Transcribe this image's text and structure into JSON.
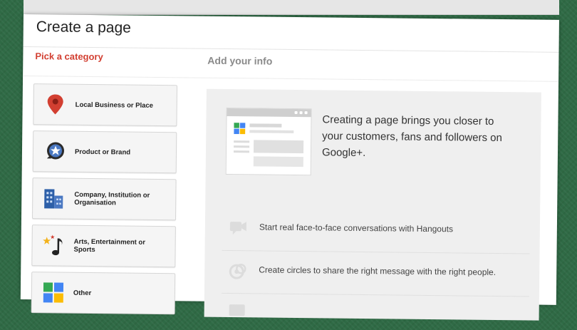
{
  "page": {
    "title": "Create a page",
    "tabs": {
      "pick_category": "Pick a category",
      "add_info": "Add your info"
    }
  },
  "categories": [
    {
      "label": "Local Business or Place",
      "icon": "map-pin-icon"
    },
    {
      "label": "Product or Brand",
      "icon": "star-badge-icon"
    },
    {
      "label": "Company, Institution or Organisation",
      "icon": "building-icon"
    },
    {
      "label": "Arts, Entertainment or Sports",
      "icon": "music-note-icon"
    },
    {
      "label": "Other",
      "icon": "grid-squares-icon"
    }
  ],
  "info": {
    "headline": "Creating a page brings you closer to your customers, fans and followers on Google+.",
    "features": [
      {
        "text": "Start real face-to-face conversations with Hangouts",
        "icon": "hangouts-icon"
      },
      {
        "text": "Create circles to share the right message with the right people.",
        "icon": "circles-icon"
      }
    ]
  },
  "colors": {
    "accent_red": "#d23f31",
    "background_green": "#2f6a45",
    "google_blue": "#4285f4",
    "google_green": "#34a853",
    "google_yellow": "#fbbc05",
    "google_red": "#ea4335"
  }
}
